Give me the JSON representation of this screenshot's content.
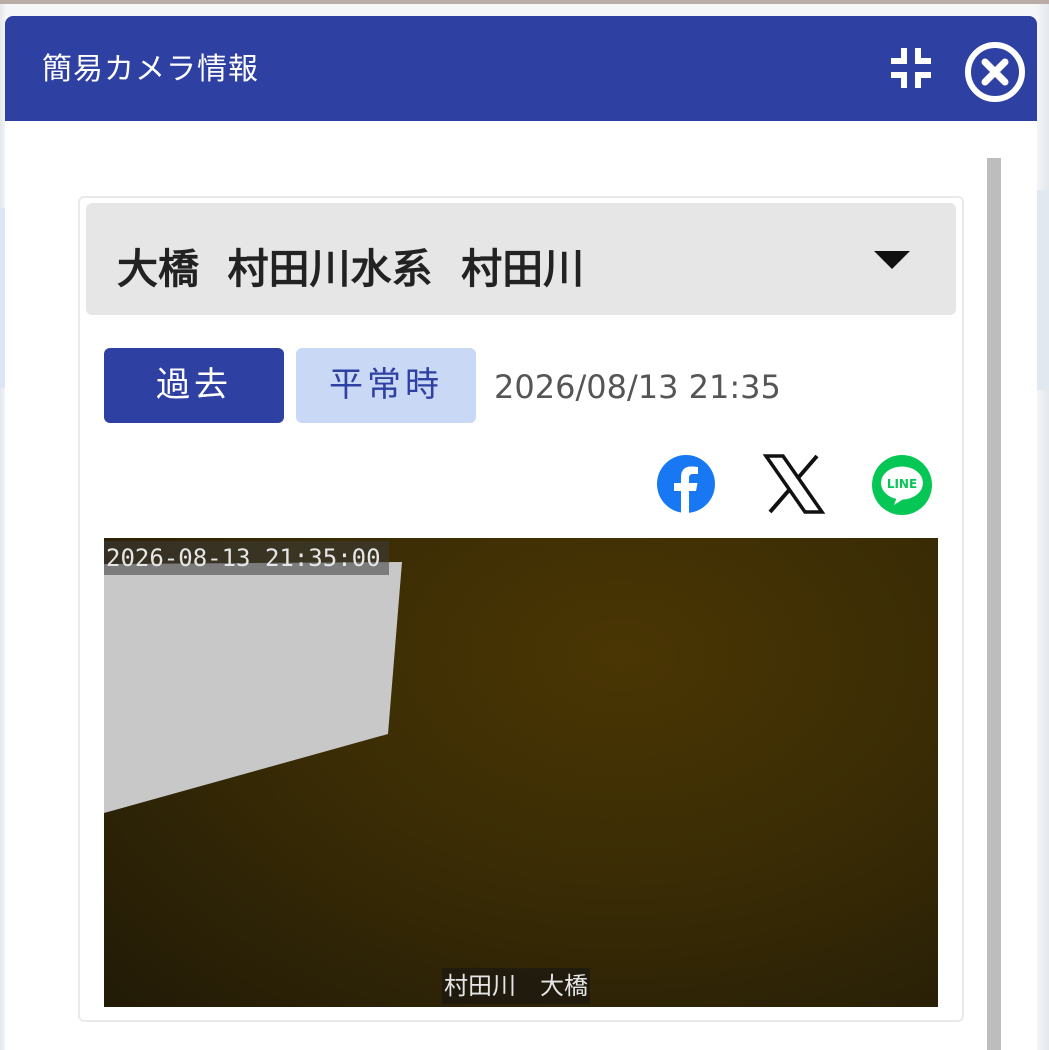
{
  "dialog": {
    "title": "簡易カメラ情報"
  },
  "station": {
    "selected": "大橋  村田川水系  村田川"
  },
  "buttons": {
    "past_label": "過去",
    "normal_label": "平常時"
  },
  "observation": {
    "datetime": "2026/08/13 21:35"
  },
  "share": {
    "line_text": "LINE"
  },
  "camera": {
    "overlay_timestamp": "2026-08-13 21:35:00",
    "overlay_location": "村田川　大橋"
  },
  "colors": {
    "header": "#2f40a3",
    "past_button": "#2f40a3",
    "normal_button": "#c9d8f5",
    "facebook": "#1877f2",
    "line": "#06c755"
  }
}
